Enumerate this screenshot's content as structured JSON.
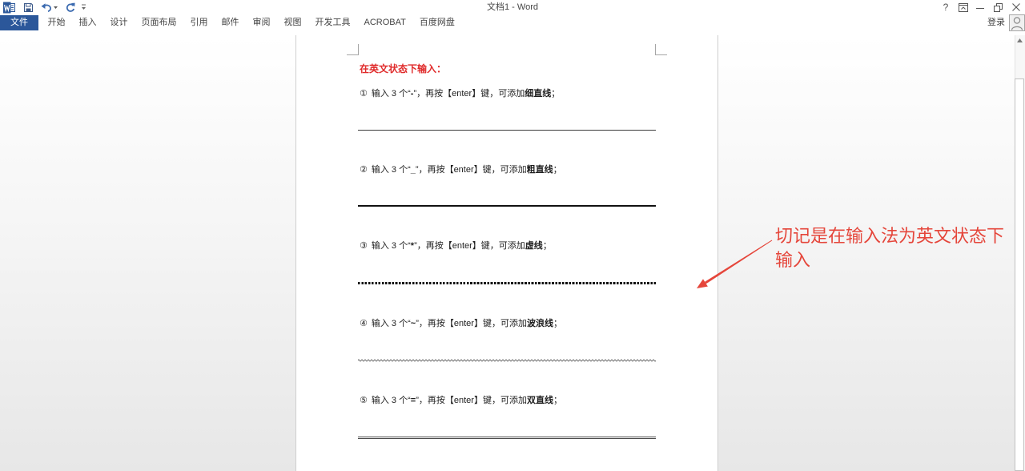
{
  "window": {
    "title": "文档1 - Word",
    "help_label": "?",
    "quick_access_icons": [
      "word-icon",
      "save-icon",
      "undo-icon",
      "dropdown-arrow-icon",
      "redo-icon",
      "customize-quick-access-icon"
    ],
    "window_control_icons": [
      "ribbon-display-options-icon",
      "minimize-icon",
      "restore-icon",
      "close-icon"
    ]
  },
  "ribbon": {
    "file_tab": "文件",
    "tabs": [
      "开始",
      "插入",
      "设计",
      "页面布局",
      "引用",
      "邮件",
      "审阅",
      "视图",
      "开发工具",
      "ACROBAT",
      "百度网盘"
    ],
    "sign_in": "登录",
    "avatar_icon": "user-avatar-icon"
  },
  "document": {
    "heading": "在英文状态下输入：",
    "items": [
      {
        "num": "①",
        "pre": "输入 3 个“",
        "symbol": "-",
        "mid": "”，再按【enter】键，可添加",
        "bold": "细直线",
        "end": "；"
      },
      {
        "num": "②",
        "pre": "输入 3 个“",
        "symbol": "_",
        "mid": "”，再按【enter】键，可添加",
        "bold": "粗直线",
        "end": "；"
      },
      {
        "num": "③",
        "pre": "输入 3 个“",
        "symbol": "*",
        "mid": "”，再按【enter】键，可添加",
        "bold": "虚线",
        "end": "；"
      },
      {
        "num": "④",
        "pre": "输入 3 个“",
        "symbol": "~",
        "mid": "”，再按【enter】键，可添加",
        "bold": "波浪线",
        "end": "；"
      },
      {
        "num": "⑤",
        "pre": "输入 3 个“",
        "symbol": "=",
        "mid": "”，再按【enter】键，可添加",
        "bold": "双直线",
        "end": "；"
      }
    ]
  },
  "annotation": {
    "text": "切记是在输入法为英文状态下输入",
    "arrow_icon": "arrow-icon"
  },
  "scrollbar_icons": [
    "scroll-up-arrow-icon"
  ],
  "colors": {
    "accent": "#2b579a",
    "heading_red": "#e02b2b",
    "annotation_red": "#e5463b",
    "page_background": "#ffffff"
  }
}
